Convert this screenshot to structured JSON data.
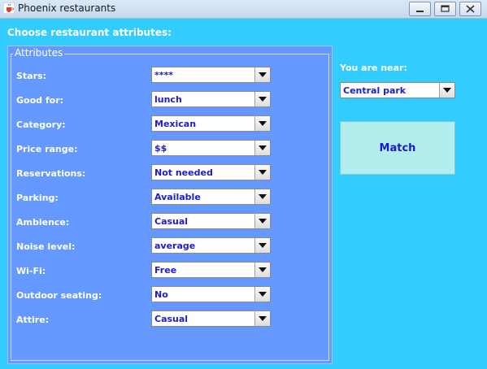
{
  "window": {
    "title": "Phoenix restaurants",
    "icon": "java-cup-icon"
  },
  "heading": "Choose restaurant attributes:",
  "attributes": {
    "legend": "Attributes",
    "rows": [
      {
        "label": "Stars:",
        "value": "****"
      },
      {
        "label": "Good for:",
        "value": "lunch"
      },
      {
        "label": "Category:",
        "value": "Mexican"
      },
      {
        "label": "Price range:",
        "value": "$$"
      },
      {
        "label": "Reservations:",
        "value": "Not needed"
      },
      {
        "label": "Parking:",
        "value": "Available"
      },
      {
        "label": "Ambience:",
        "value": "Casual"
      },
      {
        "label": "Noise level:",
        "value": "average"
      },
      {
        "label": "Wi-Fi:",
        "value": "Free"
      },
      {
        "label": "Outdoor seating:",
        "value": "No"
      },
      {
        "label": "Attire:",
        "value": "Casual"
      }
    ]
  },
  "location": {
    "label": "You are near:",
    "value": "Central park"
  },
  "match_button": "Match",
  "colors": {
    "background": "#33ccff",
    "panel": "#6699ff",
    "value_text": "#2020c0",
    "match_button": "#b2eeee"
  }
}
